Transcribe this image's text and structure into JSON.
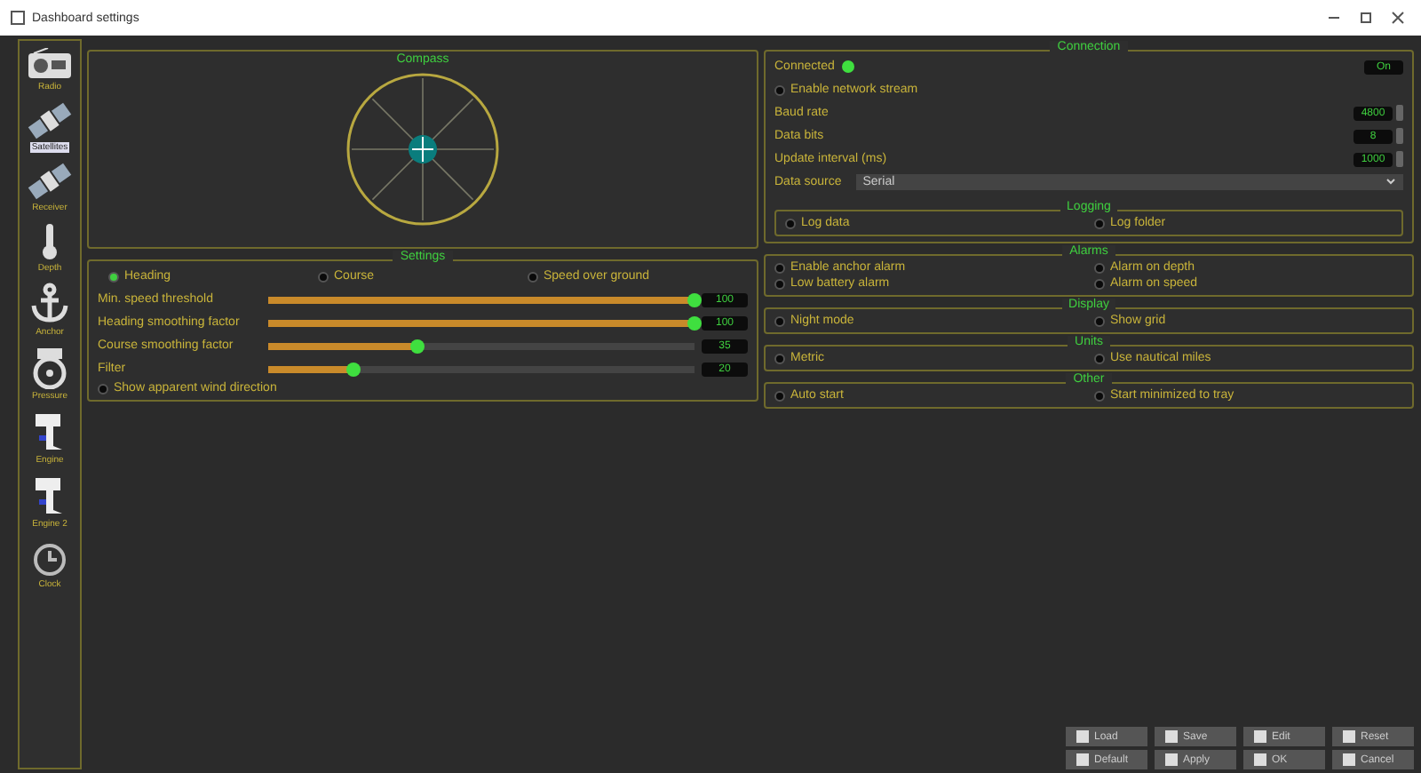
{
  "window": {
    "title": "Dashboard settings"
  },
  "sidebar": {
    "items": [
      {
        "label": "Radio",
        "kind": "radio",
        "selected": false
      },
      {
        "label": "Satellites",
        "kind": "satellite",
        "selected": true
      },
      {
        "label": "Receiver",
        "kind": "satellite",
        "selected": false
      },
      {
        "label": "Depth",
        "kind": "thermometer",
        "selected": false
      },
      {
        "label": "Anchor",
        "kind": "anchor",
        "selected": false
      },
      {
        "label": "Pressure",
        "kind": "gauge",
        "selected": false
      },
      {
        "label": "Engine",
        "kind": "engine",
        "selected": false
      },
      {
        "label": "Engine 2",
        "kind": "engine",
        "selected": false
      },
      {
        "label": "Clock",
        "kind": "clock",
        "selected": false
      }
    ]
  },
  "compass_panel": {
    "title": "Compass"
  },
  "settings_panel": {
    "title": "Settings",
    "options": [
      {
        "label": "Heading",
        "checked": true
      },
      {
        "label": "Course",
        "checked": false
      },
      {
        "label": "Speed over ground",
        "checked": false
      }
    ],
    "sliders": [
      {
        "label": "Min. speed threshold",
        "level": 1.0,
        "reading": "100"
      },
      {
        "label": "Heading smoothing factor",
        "level": 1.0,
        "reading": "100"
      },
      {
        "label": "Course smoothing factor",
        "level": 0.35,
        "reading": "35"
      },
      {
        "label": "Filter",
        "level": 0.2,
        "reading": "20"
      }
    ],
    "checkbox": {
      "label": "Show apparent wind direction",
      "checked": false
    }
  },
  "connection_panel": {
    "title": "Connection",
    "status": {
      "label": "Connected",
      "on": true,
      "reading": "On"
    },
    "checkbox": {
      "label": "Enable network stream",
      "checked": false
    },
    "spin_rows": [
      {
        "label": "Baud rate",
        "value": "4800"
      },
      {
        "label": "Data bits",
        "value": "8"
      },
      {
        "label": "Update interval (ms)",
        "value": "1000"
      }
    ],
    "dropdown": {
      "label": "Data source",
      "value": "Serial"
    },
    "subgroup": {
      "title": "Logging",
      "items": [
        {
          "label": "Log data",
          "checked": false
        },
        {
          "label": "Log folder",
          "checked": false
        }
      ]
    }
  },
  "groups": [
    {
      "title": "Alarms",
      "items": [
        {
          "label": "Enable anchor alarm",
          "checked": false
        },
        {
          "label": "Alarm on depth",
          "checked": false
        },
        {
          "label": "Low battery alarm",
          "checked": false
        },
        {
          "label": "Alarm on speed",
          "checked": false
        }
      ]
    },
    {
      "title": "Display",
      "items": [
        {
          "label": "Night mode",
          "checked": false
        },
        {
          "label": "Show grid",
          "checked": false
        }
      ]
    },
    {
      "title": "Units",
      "items": [
        {
          "label": "Metric",
          "checked": false
        },
        {
          "label": "Use nautical miles",
          "checked": false
        }
      ]
    },
    {
      "title": "Other",
      "items": [
        {
          "label": "Auto start",
          "checked": false
        },
        {
          "label": "Start minimized to tray",
          "checked": false
        }
      ]
    }
  ],
  "bottom_buttons": [
    [
      "Load",
      "Save",
      "Edit",
      "Reset"
    ],
    [
      "Default",
      "Apply",
      "OK",
      "Cancel"
    ]
  ]
}
